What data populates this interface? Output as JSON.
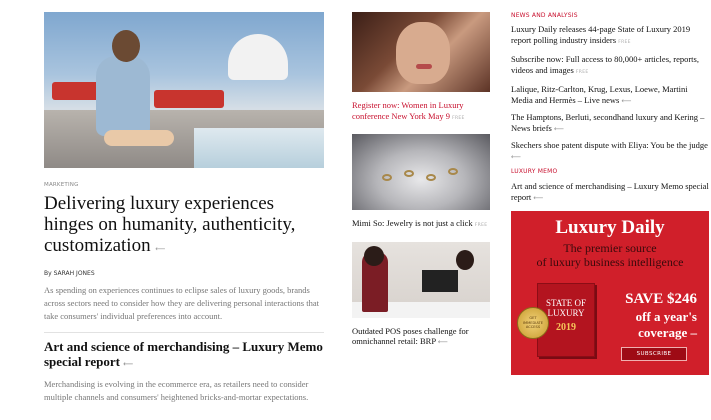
{
  "lead": {
    "kicker": "MARKETING",
    "headline": "Delivering luxury experiences hinges on humanity, authenticity, customization",
    "arrow": "⟵",
    "byline": "By SARAH JONES",
    "dek": "As spending on experiences continues to eclipse sales of luxury goods, brands across sectors need to consider how they are delivering personal interactions that take consumers' individual preferences into account."
  },
  "secondary": {
    "headline": "Art and science of merchandising – Luxury Memo special report",
    "arrow": "⟵",
    "dek": "Merchandising is evolving in the ecommerce era, as retailers need to consider multiple channels and consumers' heightened bricks-and-mortar expectations."
  },
  "middle": [
    {
      "caption": "Register now: Women in Luxury conference New York May 9",
      "tag": "FREE",
      "red": true
    },
    {
      "caption": "Mimi So: Jewelry is not just a click",
      "tag": "FREE",
      "red": false
    },
    {
      "caption": "Outdated POS poses challenge for omnichannel retail: BRP",
      "tag": "⟵",
      "red": false
    }
  ],
  "right": {
    "news_label": "NEWS AND ANALYSIS",
    "news": [
      {
        "text": "Luxury Daily releases 44-page State of Luxury 2019 report polling industry insiders",
        "tag": "FREE"
      },
      {
        "text": "Subscribe now: Full access to 80,000+ articles, reports, videos and images",
        "tag": "FREE"
      },
      {
        "text": "Lalique, Ritz-Carlton, Krug, Lexus, Loewe, Martini Media and Hermès – Live news",
        "tag": "⟵"
      },
      {
        "text": "The Hamptons, Berluti, secondhand luxury and Kering – News briefs",
        "tag": "⟵"
      },
      {
        "text": "Skechers shoe patent dispute with Eliya: You be the judge",
        "tag": "⟵"
      }
    ],
    "memo_label": "LUXURY MEMO",
    "memo": [
      {
        "text": "Art and science of merchandising – Luxury Memo special report",
        "tag": "⟵"
      }
    ]
  },
  "ad": {
    "brand": "Luxury Daily",
    "tagline1": "The premier source",
    "tagline2": "of luxury business intelligence",
    "book_title": "STATE OF LUXURY",
    "book_year": "2019",
    "seal": "GET IMMEDIATE ACCESS",
    "save1": "SAVE $246",
    "save2": "off a year's",
    "save3": "coverage –",
    "button": "SUBSCRIBE"
  },
  "colors": {
    "accent_red": "#c8102e",
    "ad_red": "#d01f2a"
  }
}
